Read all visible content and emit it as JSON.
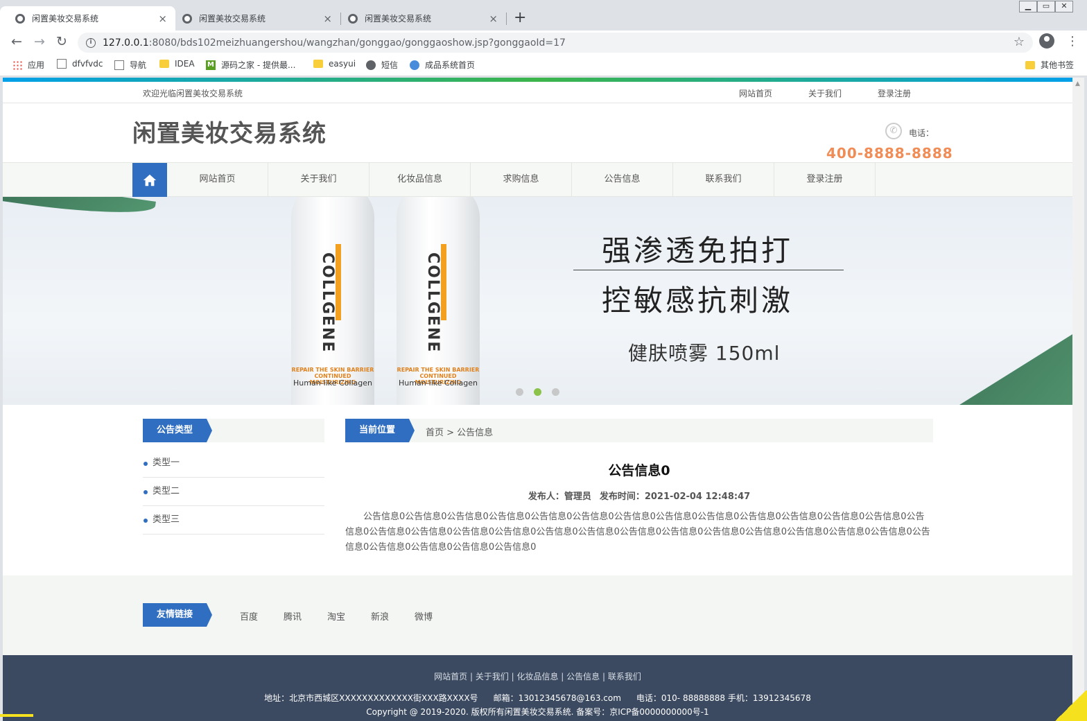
{
  "browser": {
    "tabs": [
      {
        "title": "闲置美妆交易系统",
        "active": true
      },
      {
        "title": "闲置美妆交易系统",
        "active": false
      },
      {
        "title": "闲置美妆交易系统",
        "active": false
      }
    ],
    "close_glyph": "×",
    "new_tab_glyph": "+",
    "url_host": "127.0.0.1",
    "url_rest": ":8080/bds102meizhuangershou/wangzhan/gonggao/gonggaoshow.jsp?gonggaoId=17",
    "bookmarks": [
      {
        "label": "应用",
        "icon": "apps-grid-icon"
      },
      {
        "label": "dfvfvdc",
        "icon": "page-icon"
      },
      {
        "label": "导航",
        "icon": "page-icon"
      },
      {
        "label": "IDEA",
        "icon": "folder-icon"
      },
      {
        "label": "源码之家 - 提供最...",
        "icon": "m-logo-icon"
      },
      {
        "label": "easyui",
        "icon": "folder-icon"
      },
      {
        "label": "短信",
        "icon": "globe-icon"
      },
      {
        "label": "成品系统首页",
        "icon": "home-icon"
      }
    ],
    "other_bookmarks": "其他书签"
  },
  "site": {
    "welcome": "欢迎光临闲置美妆交易系统",
    "top_links": [
      "网站首页",
      "关于我们",
      "登录注册"
    ],
    "title": "闲置美妆交易系统",
    "phone_label": "电话：",
    "phone_number": "400-8888-8888",
    "nav": [
      "网站首页",
      "关于我们",
      "化妆品信息",
      "求购信息",
      "公告信息",
      "联系我们",
      "登录注册"
    ],
    "colors": {
      "primary": "#2f6ec0",
      "accent": "#f08c55",
      "footer": "#3b4a60"
    }
  },
  "banner": {
    "bottle_name": "COLLGENE",
    "bottle_tagline": "REPAIR THE SKIN BARRIER CONTINUED MOISTURIZING",
    "bottle_sub": "Human-like Collagen",
    "slogan_line1": "强渗透免拍打",
    "slogan_line2": "控敏感抗刺激",
    "slogan_line3": "健肤喷雾 150ml",
    "dots": 3,
    "active_dot": 2
  },
  "sidebar": {
    "heading": "公告类型",
    "items": [
      "类型一",
      "类型二",
      "类型三"
    ]
  },
  "breadcrumb": {
    "heading": "当前位置",
    "path": "首页 > 公告信息"
  },
  "notice": {
    "title": "公告信息0",
    "publisher": "发布人：管理员",
    "time": "发布时间：2021-02-04 12:48:47",
    "body": "公告信息0公告信息0公告信息0公告信息0公告信息0公告信息0公告信息0公告信息0公告信息0公告信息0公告信息0公告信息0公告信息0公告信息0公告信息0公告信息0公告信息0公告信息0公告信息0公告信息0公告信息0公告信息0公告信息0公告信息0公告信息0公告信息0公告信息0公告信息0公告信息0公告信息0公告信息0公告信息0"
  },
  "friend_links": {
    "heading": "友情链接",
    "items": [
      "百度",
      "腾讯",
      "淘宝",
      "新浪",
      "微博"
    ]
  },
  "footer": {
    "nav": "网站首页 | 关于我们 | 化妆品信息 | 公告信息 | 联系我们",
    "address": "地址：北京市西城区XXXXXXXXXXXXX街XXX路XXXX号",
    "email": "邮箱：13012345678@163.com",
    "phone": "电话：010- 88888888 手机：13912345678",
    "copyright": "Copyright @ 2019-2020. 版权所有闲置美妆交易系统. 备案号：京ICP备0000000000号-1"
  }
}
